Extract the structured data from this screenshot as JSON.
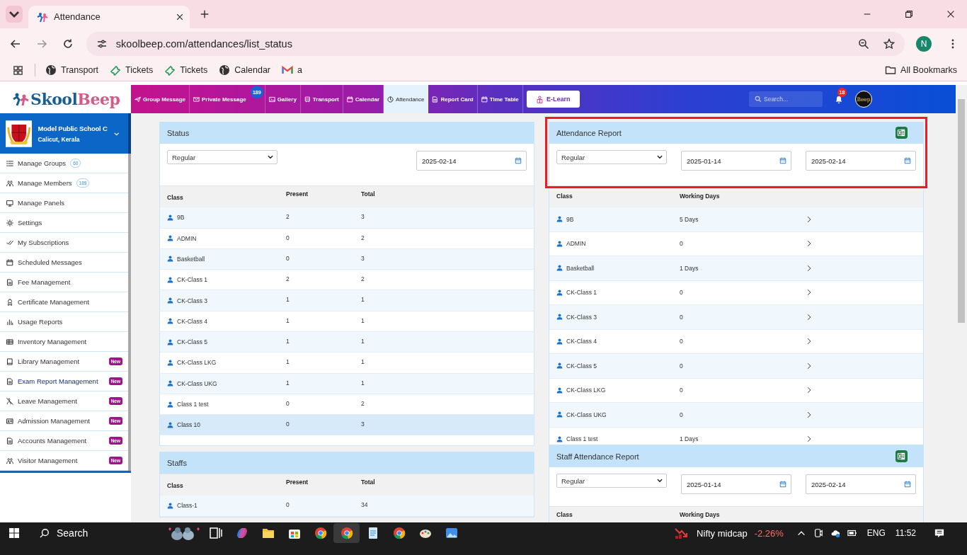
{
  "browser": {
    "tab_title": "Attendance",
    "url": "skoolbeep.com/attendances/list_status",
    "profile": "N",
    "bookmarks": [
      {
        "label": "Transport",
        "kind": "globe"
      },
      {
        "label": "Tickets",
        "kind": "ticket"
      },
      {
        "label": "Tickets",
        "kind": "ticket"
      },
      {
        "label": "Calendar",
        "kind": "globe"
      },
      {
        "label": "a",
        "kind": "mail"
      }
    ],
    "all_bookmarks": "All Bookmarks"
  },
  "app": {
    "logo": {
      "first": "Skool",
      "second": "Beep"
    },
    "nav": [
      {
        "label": "Group Message",
        "selected": false
      },
      {
        "label": "Private Message",
        "badge": "189",
        "selected": false
      },
      {
        "label": "Gallery",
        "selected": false
      },
      {
        "label": "Transport",
        "selected": false
      },
      {
        "label": "Calendar",
        "selected": false
      },
      {
        "label": "Attendance",
        "selected": true
      },
      {
        "label": "Report Card",
        "selected": false
      },
      {
        "label": "Time Table",
        "selected": false
      }
    ],
    "elearn": "E-Learn",
    "search": {
      "placeholder": "Search..."
    },
    "notifications": "18",
    "avatar": "Beep"
  },
  "sidebar": {
    "school": "Model Public School C",
    "place": "Calicut, Kerala",
    "items": [
      {
        "label": "Manage Groups",
        "count": "60",
        "selected": false
      },
      {
        "label": "Manage Members",
        "count": "189",
        "selected": false
      },
      {
        "label": "Manage Panels",
        "selected": false
      },
      {
        "label": "Settings",
        "selected": false
      },
      {
        "label": "My Subscriptions",
        "selected": false
      },
      {
        "label": "Scheduled Messages",
        "selected": false
      },
      {
        "label": "Fee Management",
        "selected": false
      },
      {
        "label": "Certificate Management",
        "selected": false
      },
      {
        "label": "Usage Reports",
        "selected": false
      },
      {
        "label": "Inventory Management",
        "selected": false
      },
      {
        "label": "Library Management",
        "badge": "New",
        "selected": false
      },
      {
        "label": "Exam Report Management",
        "badge": "New",
        "selected": true
      },
      {
        "label": "Leave Management",
        "badge": "New",
        "selected": false
      },
      {
        "label": "Admission Management",
        "badge": "New",
        "selected": false
      },
      {
        "label": "Accounts Management",
        "badge": "New",
        "selected": false
      },
      {
        "label": "Visitor Management",
        "badge": "New",
        "selected": false
      }
    ]
  },
  "status": {
    "title": "Status",
    "mode": "Regular",
    "date": "2025-02-14",
    "columns": [
      "Class",
      "Present",
      "Total"
    ],
    "rows": [
      {
        "class": "9B",
        "present": "2",
        "total": "3",
        "highlighted": false
      },
      {
        "class": "ADMIN",
        "present": "0",
        "total": "2",
        "highlighted": false
      },
      {
        "class": "Basketball",
        "present": "0",
        "total": "3",
        "highlighted": false
      },
      {
        "class": "CK-Class 1",
        "present": "2",
        "total": "2",
        "highlighted": false
      },
      {
        "class": "CK-Class 3",
        "present": "1",
        "total": "1",
        "highlighted": false
      },
      {
        "class": "CK-Class 4",
        "present": "1",
        "total": "1",
        "highlighted": false
      },
      {
        "class": "CK-Class 5",
        "present": "1",
        "total": "1",
        "highlighted": false
      },
      {
        "class": "CK-Class LKG",
        "present": "1",
        "total": "1",
        "highlighted": false
      },
      {
        "class": "CK-Class UKG",
        "present": "1",
        "total": "1",
        "highlighted": false
      },
      {
        "class": "Class 1 test",
        "present": "0",
        "total": "2",
        "highlighted": false
      },
      {
        "class": "Class 10",
        "present": "0",
        "total": "3",
        "highlighted": true
      }
    ]
  },
  "staffs": {
    "title": "Staffs",
    "columns": [
      "Class",
      "Present",
      "Total"
    ],
    "rows": [
      {
        "class": "Class-1",
        "present": "0",
        "total": "34",
        "highlighted": false
      }
    ]
  },
  "attendance_report": {
    "title": "Attendance Report",
    "highlighted": true,
    "mode": "Regular",
    "from": "2025-01-14",
    "to": "2025-02-14",
    "columns": [
      "Class",
      "Working Days"
    ],
    "rows": [
      {
        "class": "9B",
        "days": "5 Days"
      },
      {
        "class": "ADMIN",
        "days": "0"
      },
      {
        "class": "Basketball",
        "days": "1 Days"
      },
      {
        "class": "CK-Class 1",
        "days": "0"
      },
      {
        "class": "CK-Class 3",
        "days": "0"
      },
      {
        "class": "CK-Class 4",
        "days": "0"
      },
      {
        "class": "CK-Class 5",
        "days": "0"
      },
      {
        "class": "CK-Class LKG",
        "days": "0"
      },
      {
        "class": "CK-Class UKG",
        "days": "0"
      },
      {
        "class": "Class 1 test",
        "days": "1 Days"
      }
    ]
  },
  "staff_report": {
    "title": "Staff Attendance Report",
    "mode": "Regular",
    "from": "2025-01-14",
    "to": "2025-02-14",
    "columns": [
      "Class",
      "Working Days"
    ]
  },
  "taskbar": {
    "search": "Search",
    "apps": [
      {
        "kind": "taskview",
        "active": false
      },
      {
        "kind": "copilot",
        "active": false
      },
      {
        "kind": "folder",
        "active": false
      },
      {
        "kind": "store",
        "active": false
      },
      {
        "kind": "chrome",
        "active": false
      },
      {
        "kind": "chrome",
        "active": true
      },
      {
        "kind": "notepad",
        "active": false
      },
      {
        "kind": "chrome",
        "active": false
      },
      {
        "kind": "paint",
        "active": false
      },
      {
        "kind": "photos",
        "active": false
      }
    ],
    "ticker": "Nifty midcap",
    "change": "-2.26%",
    "lang": "ENG",
    "time": "11:52"
  }
}
